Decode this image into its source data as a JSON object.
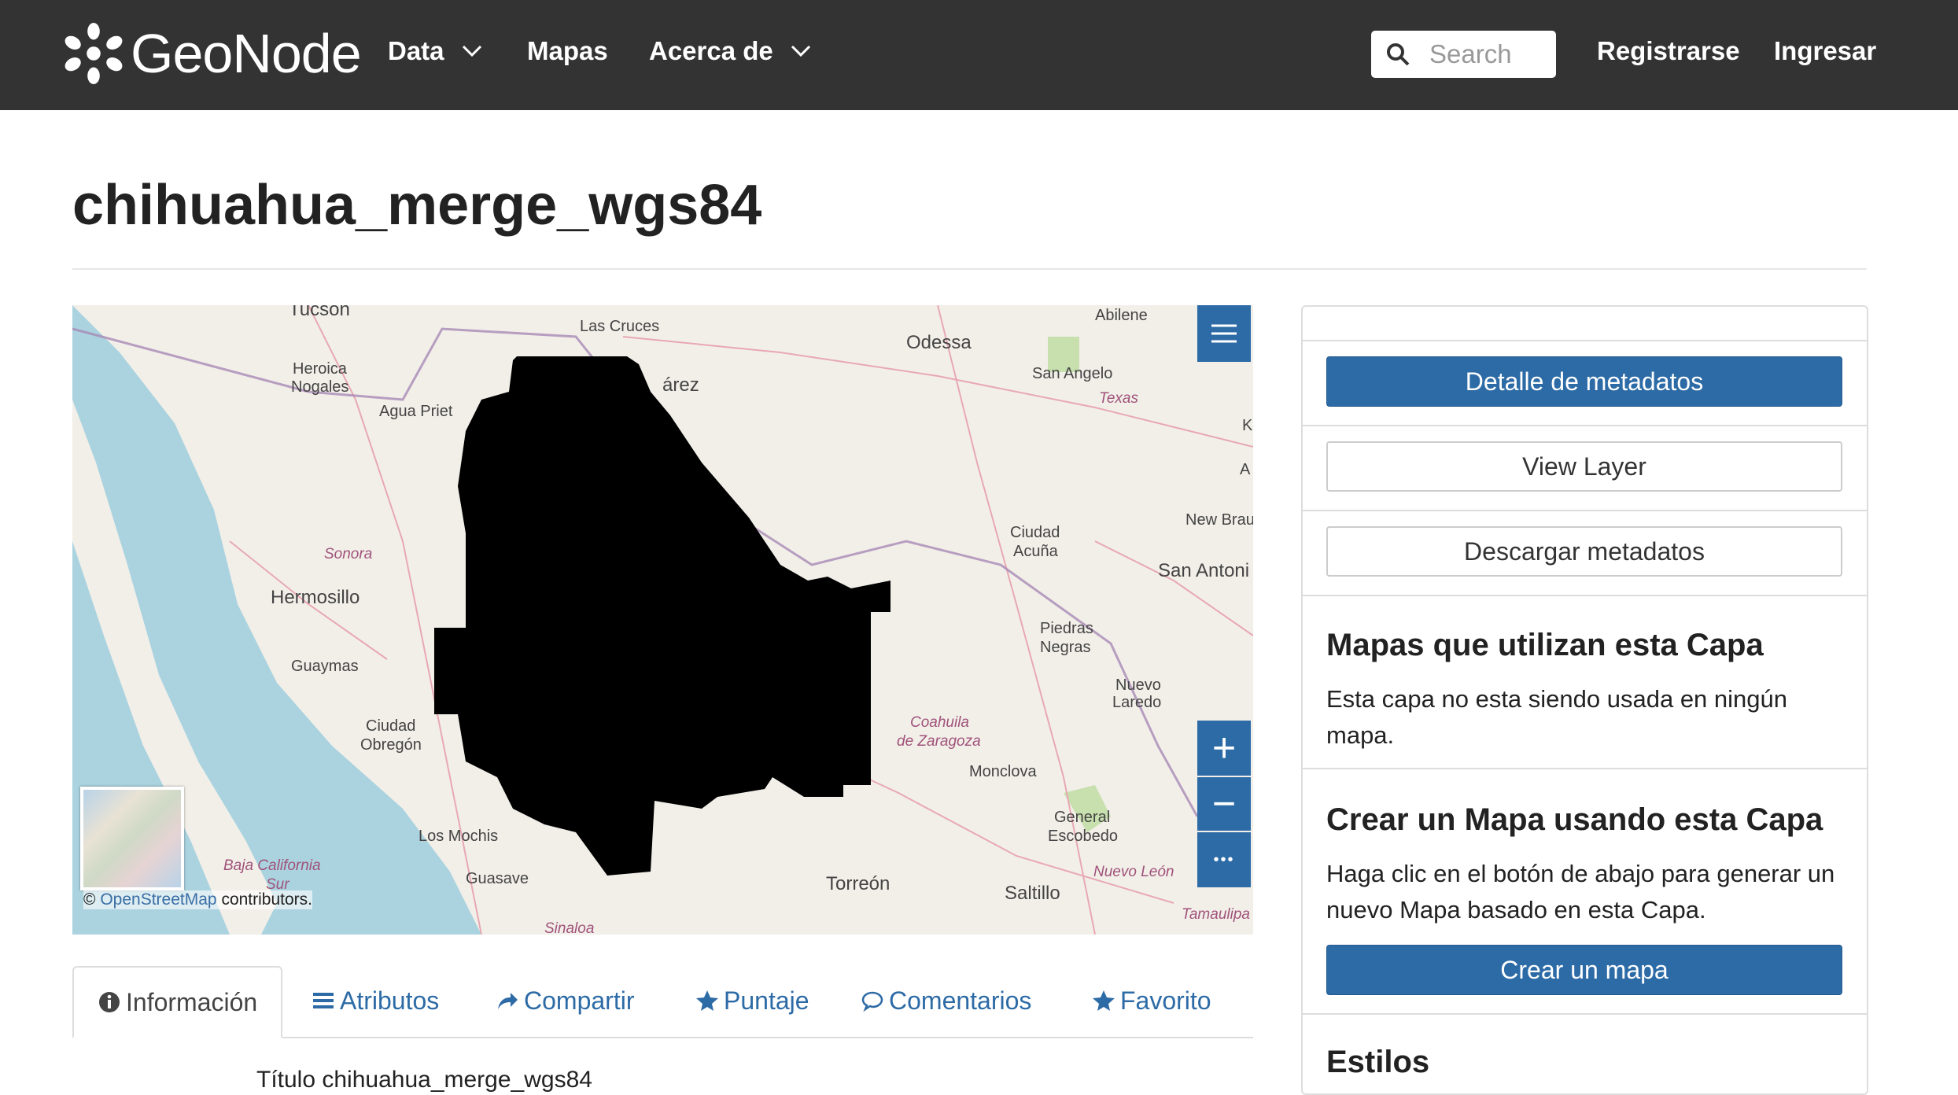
{
  "navbar": {
    "brand": "GeoNode",
    "items": [
      {
        "label": "Data",
        "dropdown": true
      },
      {
        "label": "Mapas",
        "dropdown": false
      },
      {
        "label": "Acerca de",
        "dropdown": true
      }
    ],
    "search_placeholder": "Search",
    "register": "Registrarse",
    "login": "Ingresar",
    "bg_color": "#333333"
  },
  "page": {
    "title": "chihuahua_merge_wgs84"
  },
  "map": {
    "labels": [
      "Tucson",
      "Las Cruces",
      "Abilene",
      "Odessa",
      "Heroica",
      "Nogales",
      "Agua Priet",
      "árez",
      "San Angelo",
      "Texas",
      "K",
      "A",
      "New Brau",
      "Ciudad",
      "Acuña",
      "San Antoni",
      "Sonora",
      "Hermosillo",
      "Piedras",
      "Negras",
      "Guaymas",
      "Nuevo",
      "Laredo",
      "Ciudad",
      "Obregón",
      "Coahuila",
      "de Zaragoza",
      "Monclova",
      "General",
      "Escobedo",
      "Los Mochis",
      "Baja California",
      "Sur",
      "Guasave",
      "Torreón",
      "Nuevo León",
      "Saltillo",
      "Tamaulipa",
      "Sinaloa"
    ],
    "attribution_prefix": "©",
    "attribution_link": "OpenStreetMap",
    "attribution_suffix": "contributors.",
    "controls": {
      "zoom_in": "+",
      "zoom_out": "−",
      "more": "•••"
    }
  },
  "tabs": [
    {
      "label": "Información",
      "icon": "info-icon",
      "active": true
    },
    {
      "label": "Atributos",
      "icon": "list-icon",
      "active": false
    },
    {
      "label": "Compartir",
      "icon": "share-icon",
      "active": false
    },
    {
      "label": "Puntaje",
      "icon": "star-icon",
      "active": false
    },
    {
      "label": "Comentarios",
      "icon": "comment-icon",
      "active": false
    },
    {
      "label": "Favorito",
      "icon": "star-icon",
      "active": false
    }
  ],
  "info": {
    "partial_row": "Título   chihuahua_merge_wgs84"
  },
  "sidebar": {
    "metadata_detail": "Detalle de metadatos",
    "view_layer": "View Layer",
    "download_metadata": "Descargar metadatos",
    "maps_heading": "Mapas que utilizan esta Capa",
    "maps_text": "Esta capa no esta siendo usada en ningún mapa.",
    "create_heading": "Crear un Mapa usando esta Capa",
    "create_text": "Haga clic en el botón de abajo para generar un nuevo Mapa basado en esta Capa.",
    "create_button": "Crear un mapa",
    "styles_heading": "Estilos"
  },
  "colors": {
    "primary": "#2d6ba6",
    "link": "#2d6ba6",
    "water": "#aad3df"
  }
}
